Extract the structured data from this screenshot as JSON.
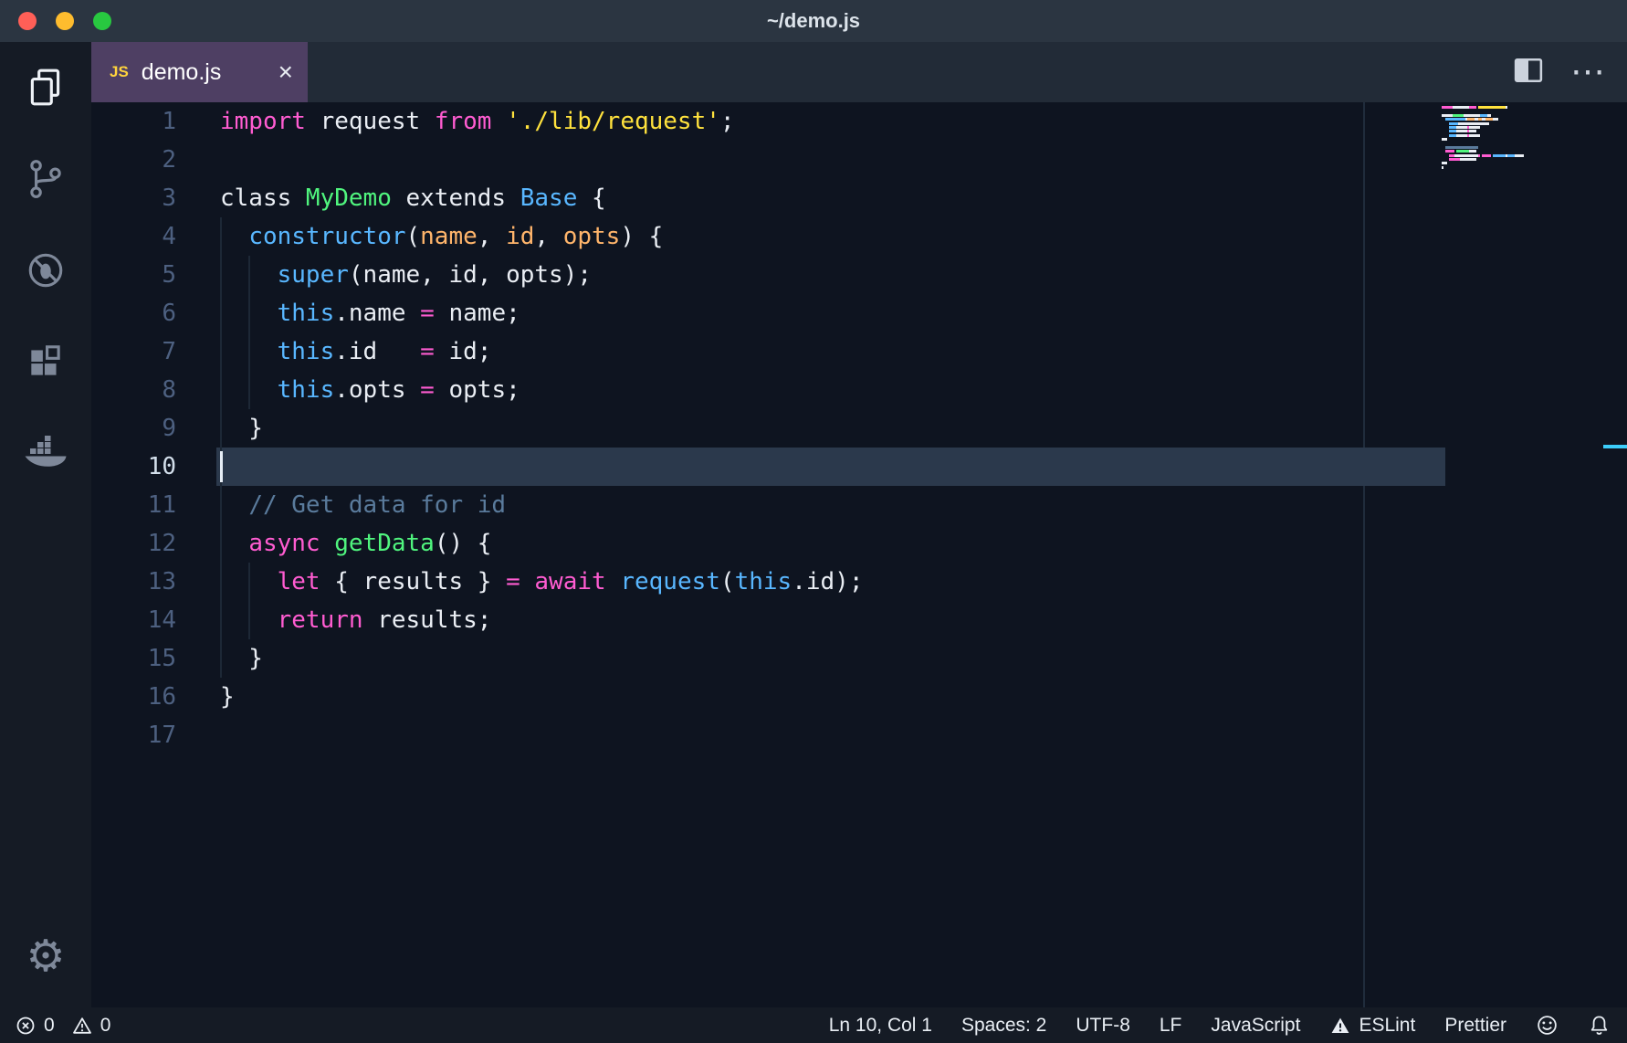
{
  "window": {
    "title": "~/demo.js"
  },
  "activity_bar": {
    "items": [
      {
        "name": "explorer",
        "icon": "files-icon",
        "active": true
      },
      {
        "name": "source-control",
        "icon": "git-branch-icon",
        "active": false
      },
      {
        "name": "debug",
        "icon": "bug-slash-icon",
        "active": false
      },
      {
        "name": "extensions",
        "icon": "extensions-icon",
        "active": false
      },
      {
        "name": "docker",
        "icon": "docker-whale-icon",
        "active": false
      }
    ],
    "bottom_items": [
      {
        "name": "settings",
        "icon": "gear-icon",
        "glyph": "⚙"
      }
    ]
  },
  "tab": {
    "label": "demo.js",
    "language_badge": "JS",
    "close_icon": "×",
    "active_bg": "#4e3f63"
  },
  "editor_actions": {
    "split_icon": "split-editor-icon",
    "more_icon": "⋯"
  },
  "colors": {
    "kw": "#ff5cd1",
    "fg": "#eaeef4",
    "str": "#ffe23d",
    "ent": "#50f57e",
    "fn": "#59b7ff",
    "param": "#ffb56b",
    "cmt": "#5a7b9c",
    "editor_bg": "#0e1420",
    "current_line_bg": "#2b394c",
    "line_number": "#4d6080",
    "line_number_active": "#d3dfeb",
    "overview_cursor_mark": "#3ccdfa"
  },
  "editor": {
    "cursor": {
      "line": 10,
      "col": 1
    },
    "lines": [
      {
        "n": 1,
        "tokens": [
          [
            "import",
            "kw"
          ],
          [
            " request ",
            "fg"
          ],
          [
            "from",
            "kw"
          ],
          [
            " ",
            "fg"
          ],
          [
            "'./lib/request'",
            "str"
          ],
          [
            ";",
            "fg"
          ]
        ]
      },
      {
        "n": 2,
        "tokens": []
      },
      {
        "n": 3,
        "tokens": [
          [
            "class ",
            "fg"
          ],
          [
            "MyDemo",
            "ent"
          ],
          [
            " extends ",
            "fg"
          ],
          [
            "Base",
            "fn"
          ],
          [
            " {",
            "fg"
          ]
        ]
      },
      {
        "n": 4,
        "tokens": [
          [
            "  ",
            "fg"
          ],
          [
            "constructor",
            "fn"
          ],
          [
            "(",
            "fg"
          ],
          [
            "name",
            "param"
          ],
          [
            ", ",
            "fg"
          ],
          [
            "id",
            "param"
          ],
          [
            ", ",
            "fg"
          ],
          [
            "opts",
            "param"
          ],
          [
            ") {",
            "fg"
          ]
        ]
      },
      {
        "n": 5,
        "tokens": [
          [
            "    ",
            "fg"
          ],
          [
            "super",
            "fn"
          ],
          [
            "(name, id, opts);",
            "fg"
          ]
        ]
      },
      {
        "n": 6,
        "tokens": [
          [
            "    ",
            "fg"
          ],
          [
            "this",
            "fn"
          ],
          [
            ".name ",
            "fg"
          ],
          [
            "=",
            "kw"
          ],
          [
            " name;",
            "fg"
          ]
        ]
      },
      {
        "n": 7,
        "tokens": [
          [
            "    ",
            "fg"
          ],
          [
            "this",
            "fn"
          ],
          [
            ".id   ",
            "fg"
          ],
          [
            "=",
            "kw"
          ],
          [
            " id;",
            "fg"
          ]
        ]
      },
      {
        "n": 8,
        "tokens": [
          [
            "    ",
            "fg"
          ],
          [
            "this",
            "fn"
          ],
          [
            ".opts ",
            "fg"
          ],
          [
            "=",
            "kw"
          ],
          [
            " opts;",
            "fg"
          ]
        ]
      },
      {
        "n": 9,
        "tokens": [
          [
            "  }",
            "fg"
          ]
        ]
      },
      {
        "n": 10,
        "tokens": []
      },
      {
        "n": 11,
        "tokens": [
          [
            "  ",
            "fg"
          ],
          [
            "// Get data for id",
            "cmt"
          ]
        ]
      },
      {
        "n": 12,
        "tokens": [
          [
            "  ",
            "fg"
          ],
          [
            "async",
            "kw"
          ],
          [
            " ",
            "fg"
          ],
          [
            "getData",
            "ent"
          ],
          [
            "() {",
            "fg"
          ]
        ]
      },
      {
        "n": 13,
        "tokens": [
          [
            "    ",
            "fg"
          ],
          [
            "let",
            "kw"
          ],
          [
            " { results } ",
            "fg"
          ],
          [
            "=",
            "kw"
          ],
          [
            " ",
            "fg"
          ],
          [
            "await",
            "kw"
          ],
          [
            " ",
            "fg"
          ],
          [
            "request",
            "fn"
          ],
          [
            "(",
            "fg"
          ],
          [
            "this",
            "fn"
          ],
          [
            ".id);",
            "fg"
          ]
        ]
      },
      {
        "n": 14,
        "tokens": [
          [
            "    ",
            "fg"
          ],
          [
            "return",
            "kw"
          ],
          [
            " results;",
            "fg"
          ]
        ]
      },
      {
        "n": 15,
        "tokens": [
          [
            "  }",
            "fg"
          ]
        ]
      },
      {
        "n": 16,
        "tokens": [
          [
            "}",
            "fg"
          ]
        ]
      },
      {
        "n": 17,
        "tokens": []
      }
    ]
  },
  "status_bar": {
    "left": [
      {
        "name": "error-count",
        "icon": "error-circle",
        "label": "0"
      },
      {
        "name": "warning-count",
        "icon": "warning",
        "label": "0"
      }
    ],
    "right": [
      {
        "name": "cursor-position",
        "label": "Ln 10, Col 1"
      },
      {
        "name": "indentation",
        "label": "Spaces: 2"
      },
      {
        "name": "encoding",
        "label": "UTF-8"
      },
      {
        "name": "end-of-line",
        "label": "LF"
      },
      {
        "name": "language-mode",
        "label": "JavaScript"
      },
      {
        "name": "eslint-status",
        "icon": "warning-filled",
        "label": "ESLint"
      },
      {
        "name": "prettier-status",
        "label": "Prettier"
      },
      {
        "name": "feedback-smiley",
        "icon": "smiley"
      },
      {
        "name": "notifications-bell",
        "icon": "bell"
      }
    ]
  }
}
